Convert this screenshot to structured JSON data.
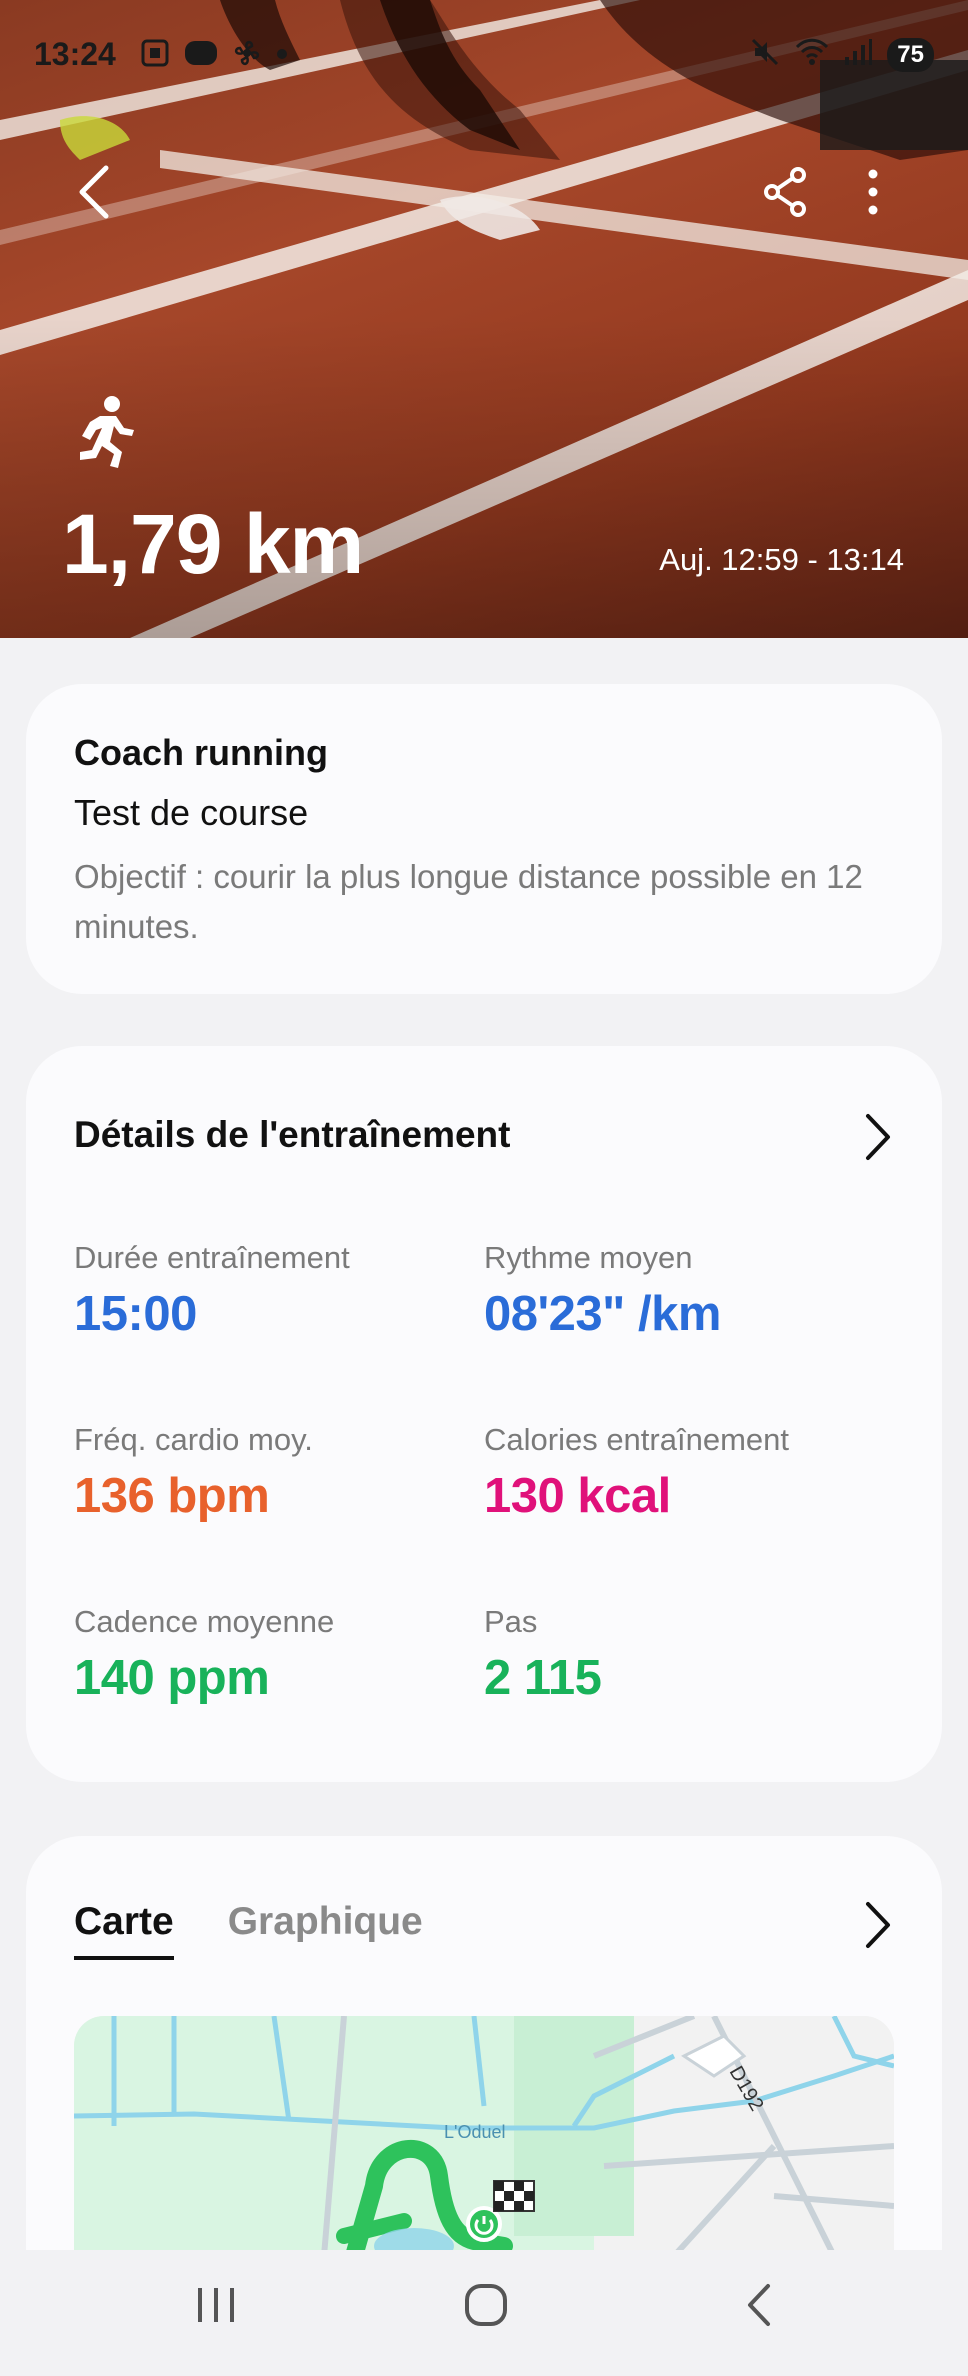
{
  "status": {
    "time": "13:24",
    "battery": "75"
  },
  "hero": {
    "distance": "1,79 km",
    "time_range": "Auj. 12:59 - 13:14"
  },
  "coach": {
    "title": "Coach running",
    "subtitle": "Test de course",
    "description": "Objectif : courir la plus longue distance possible en 12 minutes."
  },
  "details": {
    "title": "Détails de l'entraînement",
    "stats": [
      {
        "label": "Durée entraînement",
        "value": "15:00",
        "color": "#2a6cd8"
      },
      {
        "label": "Rythme moyen",
        "value": "08'23\" /km",
        "color": "#2a6cd8"
      },
      {
        "label": "Fréq. cardio moy.",
        "value": "136 bpm",
        "color": "#e8612c"
      },
      {
        "label": "Calories entraînement",
        "value": "130 kcal",
        "color": "#e0117a"
      },
      {
        "label": "Cadence moyenne",
        "value": "140 ppm",
        "color": "#18b25a"
      },
      {
        "label": "Pas",
        "value": "2 115",
        "color": "#18b25a"
      }
    ]
  },
  "map_section": {
    "tabs": [
      {
        "label": "Carte",
        "active": true
      },
      {
        "label": "Graphique",
        "active": false
      }
    ],
    "map_labels": {
      "river": "L'Oduel",
      "road": "D192"
    }
  },
  "icons": {
    "back": "chevron-left-icon",
    "share": "share-icon",
    "more": "more-vertical-icon",
    "activity": "running-icon",
    "nav_recents": "recents-icon",
    "nav_home": "home-icon",
    "nav_back": "back-icon"
  }
}
